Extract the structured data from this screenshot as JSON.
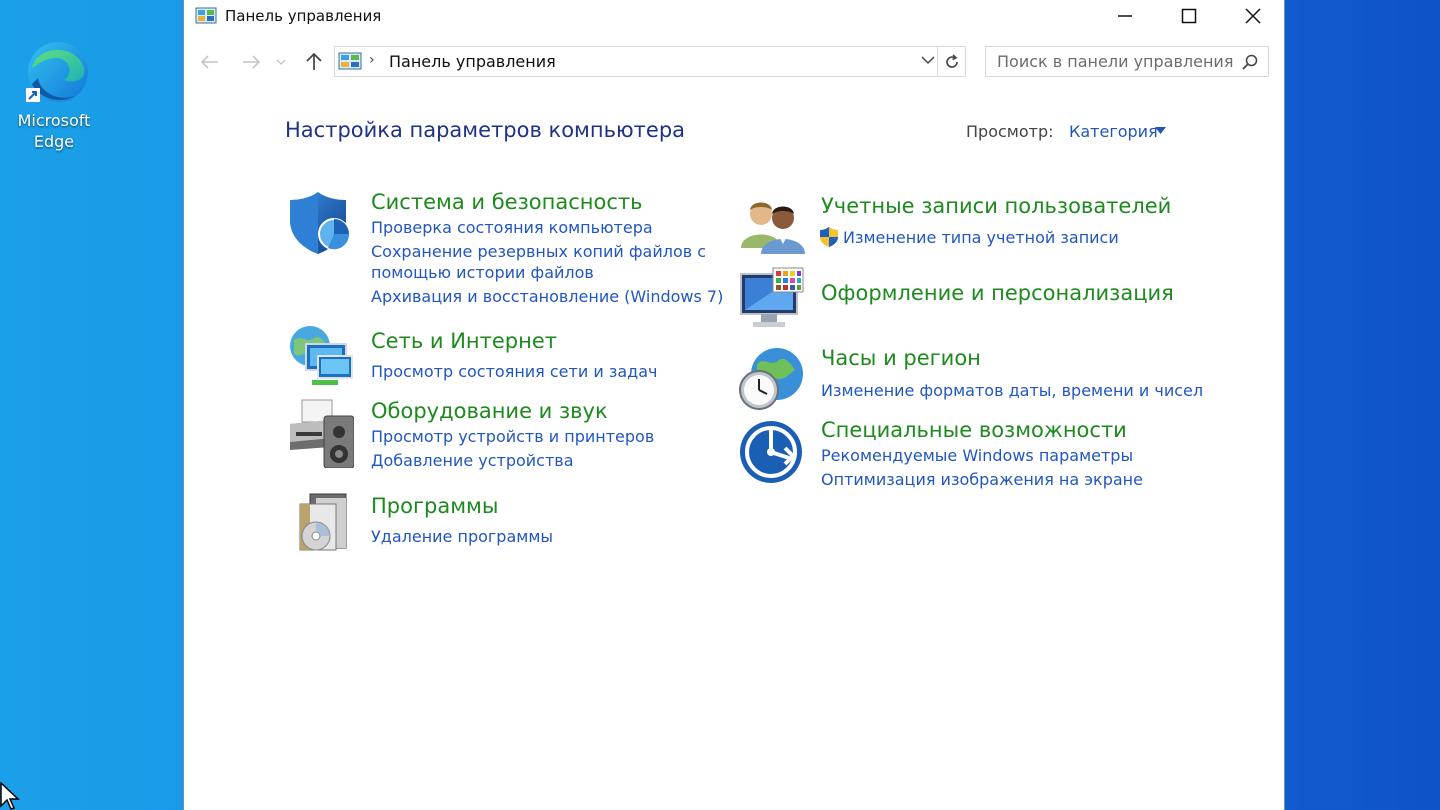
{
  "desktop": {
    "icon_label_line1": "Microsoft",
    "icon_label_line2": "Edge"
  },
  "window": {
    "title": "Панель управления",
    "controls": [
      "minimize-icon",
      "maximize-icon",
      "close-icon"
    ]
  },
  "nav": {
    "address_path": "Панель управления",
    "search_placeholder": "Поиск в панели управления"
  },
  "main": {
    "heading": "Настройка параметров компьютера",
    "view_label": "Просмотр:",
    "view_value": "Категория"
  },
  "categories": {
    "system": {
      "title": "Система и безопасность",
      "links": [
        "Проверка состояния компьютера",
        "Сохранение резервных копий файлов с",
        "помощью истории файлов",
        "Архивация и восстановление (Windows 7)"
      ]
    },
    "network": {
      "title": "Сеть и Интернет",
      "links": [
        "Просмотр состояния сети и задач"
      ]
    },
    "hardware": {
      "title": "Оборудование и звук",
      "links": [
        "Просмотр устройств и принтеров",
        "Добавление устройства"
      ]
    },
    "programs": {
      "title": "Программы",
      "links": [
        "Удаление программы"
      ]
    },
    "users": {
      "title": "Учетные записи пользователей",
      "links": [
        "Изменение типа учетной записи"
      ]
    },
    "appearance": {
      "title": "Оформление и персонализация"
    },
    "clock": {
      "title": "Часы и регион",
      "links": [
        "Изменение форматов даты, времени и чисел"
      ]
    },
    "access": {
      "title": "Специальные возможности",
      "links": [
        "Рекомендуемые Windows параметры",
        "Оптимизация изображения на экране"
      ]
    }
  },
  "colors": {
    "category_title": "#1e8a1e",
    "link": "#2256c1",
    "heading": "#1e3287"
  }
}
